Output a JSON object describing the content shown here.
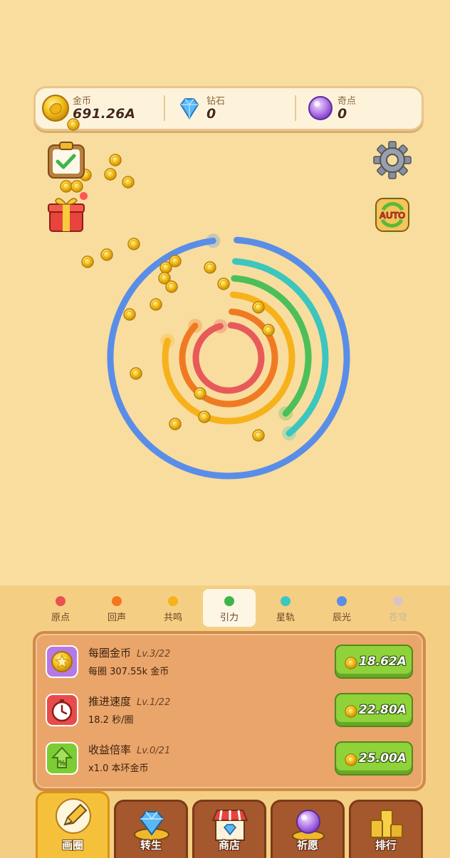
{
  "resources": {
    "gold": {
      "label": "金币",
      "value": "691.26A",
      "icon": "gold-coin-icon"
    },
    "diamond": {
      "label": "钻石",
      "value": "0",
      "icon": "diamond-icon"
    },
    "rare_point": {
      "label": "奇点",
      "value": "0",
      "icon": "purple-orb-icon"
    }
  },
  "side_buttons": {
    "tasks": "clipboard-check-icon",
    "gift": "gift-box-icon",
    "settings": "gear-icon",
    "auto": {
      "label": "AUTO",
      "icon": "auto-cycle-icon"
    }
  },
  "rings": [
    {
      "name": "原点",
      "color": "#e85a5a",
      "progress": 0.97
    },
    {
      "name": "回声",
      "color": "#f07a22",
      "progress": 0.88
    },
    {
      "name": "共鸣",
      "color": "#f7b21b",
      "progress": 0.8
    },
    {
      "name": "引力",
      "color": "#4cbf58",
      "progress": 0.37
    },
    {
      "name": "星轨",
      "color": "#3cc6bd",
      "progress": 0.39
    },
    {
      "name": "辰光",
      "color": "#5a8de8",
      "progress": 0.99
    }
  ],
  "tabs": [
    {
      "label": "原点",
      "color": "#ea5252",
      "state": "normal"
    },
    {
      "label": "回声",
      "color": "#f5751f",
      "state": "normal"
    },
    {
      "label": "共鸣",
      "color": "#f7b21b",
      "state": "normal"
    },
    {
      "label": "引力",
      "color": "#3fb44a",
      "state": "active"
    },
    {
      "label": "星轨",
      "color": "#3fc6bf",
      "state": "normal"
    },
    {
      "label": "辰光",
      "color": "#5c8de6",
      "state": "normal"
    },
    {
      "label": "苍穹",
      "color": "#dcc3c3",
      "state": "locked"
    }
  ],
  "upgrades": [
    {
      "name": "每圈金币",
      "level": "Lv.3/22",
      "desc": "每圈 307.55k 金币",
      "price": "18.62A",
      "icon": "coin-star-icon",
      "icon_color": "#b678e6"
    },
    {
      "name": "推进速度",
      "level": "Lv.1/22",
      "desc": "18.2 秒/圈",
      "price": "22.80A",
      "icon": "stopwatch-icon",
      "icon_color": "#e84b4b"
    },
    {
      "name": "收益倍率",
      "level": "Lv.0/21",
      "desc": "x1.0 本环金币",
      "price": "25.00A",
      "icon": "percent-arrow-icon",
      "icon_color": "#7ccc34"
    }
  ],
  "nav": [
    {
      "label": "画圈",
      "icon": "pencil-icon",
      "state": "active"
    },
    {
      "label": "转生",
      "icon": "diamond-rebirth-icon",
      "state": "normal"
    },
    {
      "label": "商店",
      "icon": "shop-icon",
      "state": "normal"
    },
    {
      "label": "祈愿",
      "icon": "wish-orb-icon",
      "state": "normal"
    },
    {
      "label": "排行",
      "icon": "podium-icon",
      "state": "normal"
    }
  ]
}
